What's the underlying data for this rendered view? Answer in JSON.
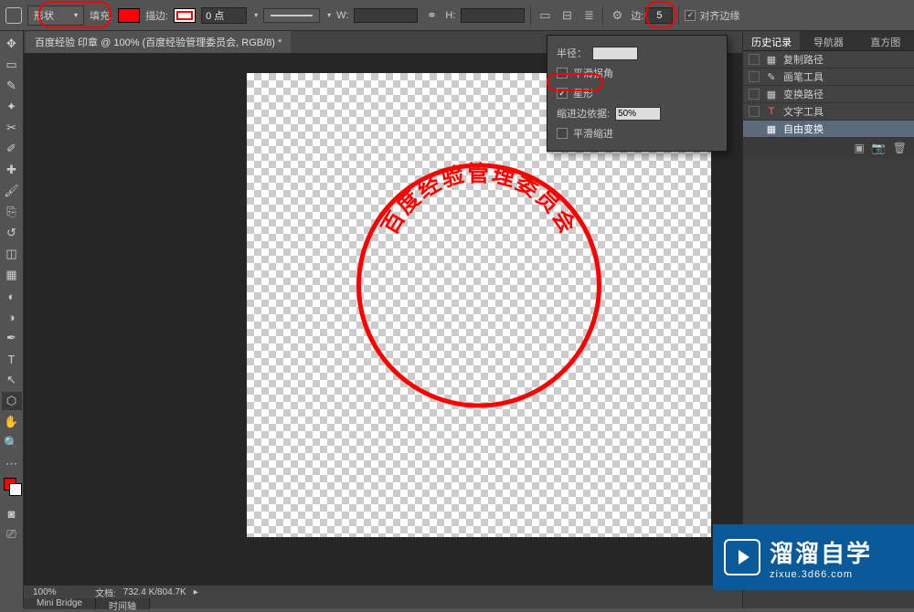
{
  "topbar": {
    "shape_mode": "形状",
    "fill_label": "填充:",
    "stroke_label": "描边:",
    "stroke_width": "0 点",
    "w_label": "W:",
    "h_label": "H:",
    "sides_label": "边:",
    "sides_value": "5",
    "align_label": "对齐边缘",
    "align_checked": true
  },
  "document": {
    "tab_title": "百度经验 印章 @ 100% (百度经验管理委员会, RGB/8) *"
  },
  "popup": {
    "radius_label": "半径：",
    "radius_value": "",
    "smooth_corners": "平滑拐角",
    "star": "星形",
    "star_checked": true,
    "indent_label": "缩进边依据:",
    "indent_value": "50%",
    "smooth_indent": "平滑缩进"
  },
  "panel": {
    "tabs": [
      "历史记录",
      "导航器",
      "直方图"
    ],
    "history": [
      {
        "icon": "▦",
        "label": "复制路径"
      },
      {
        "icon": "✎",
        "label": "画笔工具"
      },
      {
        "icon": "▦",
        "label": "变换路径"
      },
      {
        "icon": "T",
        "label": "文字工具"
      },
      {
        "icon": "▦",
        "label": "自由变换"
      }
    ]
  },
  "canvas": {
    "arc_text": "百度经验管理委员会"
  },
  "status": {
    "zoom": "100%",
    "doc_info_label": "文档:",
    "doc_info": "732.4 K/804.7K",
    "tabs": [
      "Mini Bridge",
      "时间轴"
    ]
  },
  "watermark": {
    "title": "溜溜自学",
    "subtitle": "zixue.3d66.com"
  },
  "tools": [
    "⬚",
    "▭",
    "↔",
    "✥",
    "▭",
    "⌖",
    "✎",
    "✎",
    "▤",
    "⌫",
    "◐",
    "◒",
    "●",
    "✎",
    "T",
    "↗",
    "⬡",
    "✋",
    "🔍"
  ]
}
